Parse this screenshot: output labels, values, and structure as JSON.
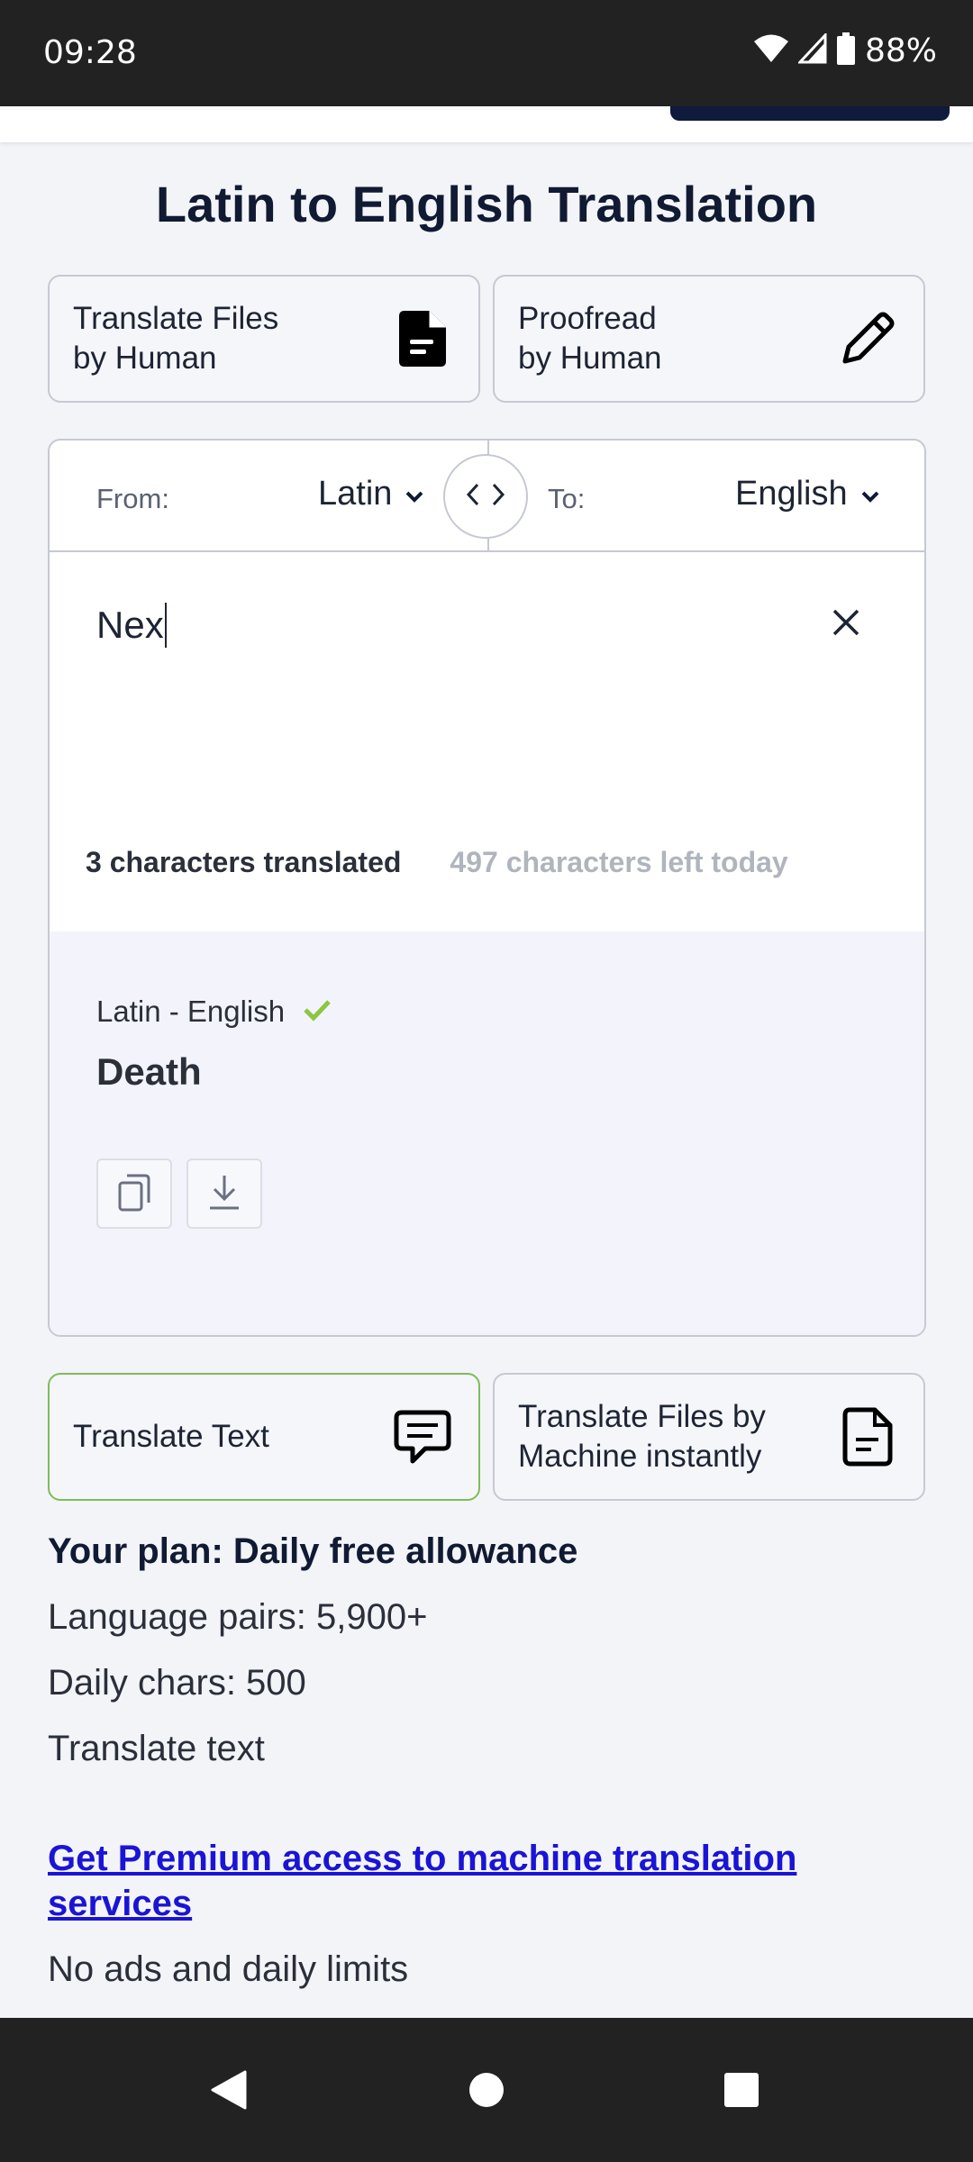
{
  "status_bar": {
    "time": "09:28",
    "battery_percent": "88%",
    "icons": [
      "wifi-icon",
      "signal-icon",
      "battery-icon"
    ]
  },
  "page_title": "Latin to English Translation",
  "service_buttons": {
    "translate_files_human": "Translate Files\nby Human",
    "proofread_human": "Proofread\nby Human"
  },
  "translator": {
    "from_label": "From:",
    "from_language": "Latin",
    "to_label": "To:",
    "to_language": "English",
    "input_value": "Nex",
    "chars_translated": "3 characters translated",
    "chars_left": "497 characters left today",
    "output": {
      "pair": "Latin - English",
      "text": "Death"
    }
  },
  "mode_buttons": {
    "translate_text": "Translate Text",
    "translate_files_machine": "Translate Files by\nMachine instantly"
  },
  "plan": {
    "title": "Your plan: Daily free allowance",
    "language_pairs": "Language pairs: 5,900+",
    "daily_chars": "Daily chars: 500",
    "feature": "Translate text",
    "premium_link": "Get Premium access to machine translation services",
    "note": "No ads and daily limits"
  },
  "colors": {
    "primary_dark": "#101a3c",
    "active_border": "#7cbd5b",
    "link": "#1a14d6",
    "check": "#8dc63f"
  }
}
